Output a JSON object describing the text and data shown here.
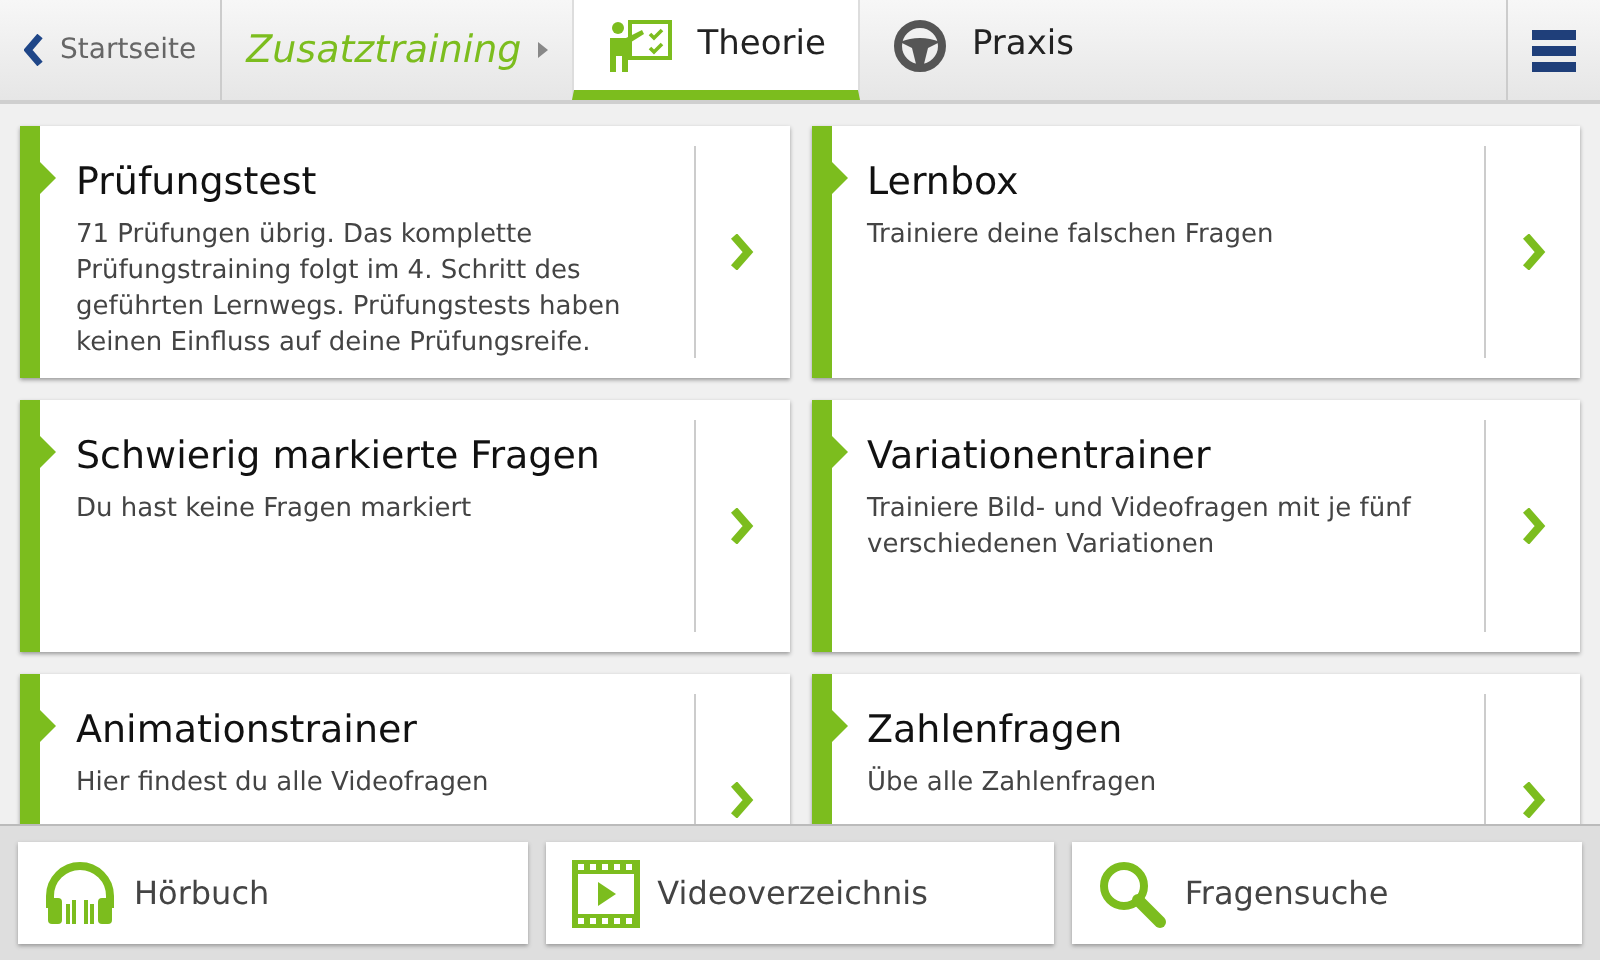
{
  "nav": {
    "back": "Startseite",
    "breadcrumb": "Zusatztraining",
    "tabs": [
      {
        "label": "Theorie",
        "selected": true
      },
      {
        "label": "Praxis",
        "selected": false
      }
    ]
  },
  "cards": [
    {
      "title": "Prüfungstest",
      "text": "71 Prüfungen übrig. Das komplette Prüfungstraining folgt im 4. Schritt des geführten Lernwegs. Prüfungstests haben keinen Einfluss auf deine Prüfungsreife."
    },
    {
      "title": "Lernbox",
      "text": "Trainiere deine falschen Fragen"
    },
    {
      "title": "Schwierig markierte Fragen",
      "text": "Du hast keine Fragen markiert"
    },
    {
      "title": "Variationentrainer",
      "text": "Trainiere Bild- und Videofragen mit je fünf verschiedenen Variationen"
    },
    {
      "title": "Animationstrainer",
      "text": "Hier findest du alle Videofragen"
    },
    {
      "title": "Zahlenfragen",
      "text": "Übe alle Zahlenfragen"
    }
  ],
  "bottom": [
    {
      "label": "Hörbuch"
    },
    {
      "label": "Videoverzeichnis"
    },
    {
      "label": "Fragensuche"
    }
  ]
}
